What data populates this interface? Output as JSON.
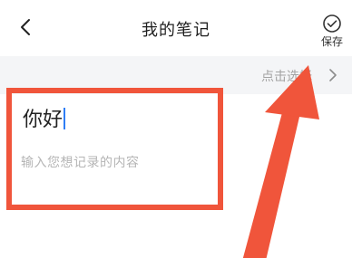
{
  "header": {
    "back_icon": "chevron-left-icon",
    "title": "我的笔记",
    "save_icon": "check-circle-icon",
    "save_label": "保存"
  },
  "select_row": {
    "label": "点击选择",
    "chevron_icon": "chevron-right-icon"
  },
  "note": {
    "title": "你好",
    "content_placeholder": "输入您想记录的内容"
  },
  "annotation": {
    "color": "#f0553b"
  }
}
